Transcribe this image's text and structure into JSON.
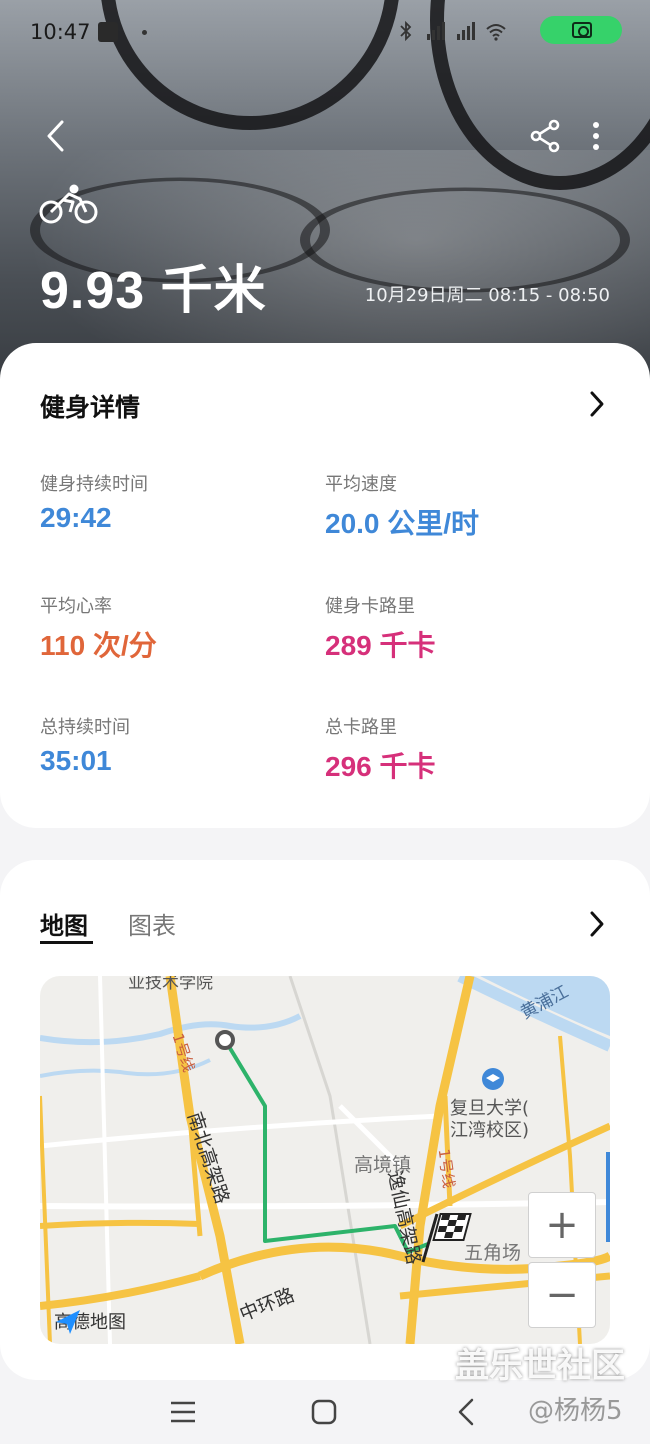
{
  "status_bar": {
    "time": "10:47"
  },
  "header": {
    "distance": "9.93 千米",
    "time_range": "10月29日周二 08:15 - 08:50"
  },
  "details": {
    "title": "健身详情",
    "stats": [
      {
        "label": "健身持续时间",
        "value": "29:42",
        "color": "#3f88d8"
      },
      {
        "label": "平均速度",
        "value": "20.0 公里/时",
        "color": "#3f88d8"
      },
      {
        "label": "平均心率",
        "value": "110 次/分",
        "color": "#e0663a"
      },
      {
        "label": "健身卡路里",
        "value": "289 千卡",
        "color": "#d6307a"
      },
      {
        "label": "总持续时间",
        "value": "35:01",
        "color": "#3f88d8"
      },
      {
        "label": "总卡路里",
        "value": "296 千卡",
        "color": "#d6307a"
      }
    ]
  },
  "map_section": {
    "tabs": [
      "地图",
      "图表"
    ],
    "active_tab": "地图",
    "labels": {
      "top_school": "业技术学院",
      "river": "黄浦江",
      "university": "复旦大学(江湾校区)",
      "university_line1": "复旦大学(",
      "university_line2": "江湾校区)",
      "metro_left": "1号线",
      "highway_left": "南北高架路",
      "town": "高境镇",
      "highway_right": "逸仙高架路",
      "metro_right": "1号线",
      "wujiaochang": "五角场",
      "ring": "中环路",
      "provider": "高德地图"
    },
    "zoom_in": "+",
    "zoom_out": "−",
    "route_color": "#2db36a"
  },
  "watermark": {
    "brand": "盖乐世社区",
    "user": "@杨杨5"
  }
}
